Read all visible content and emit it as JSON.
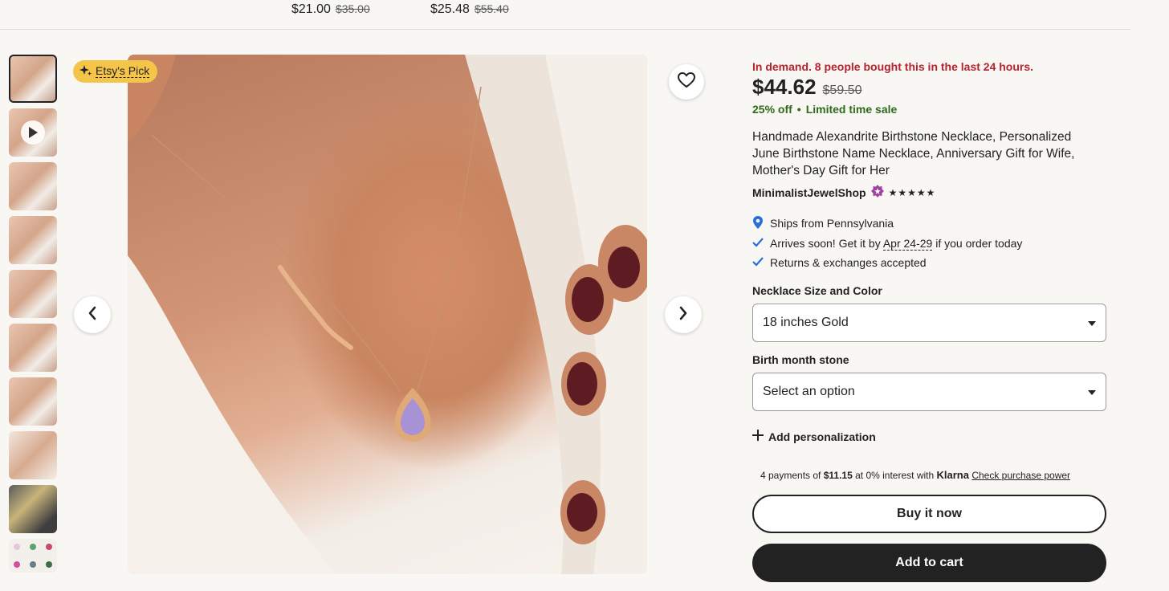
{
  "recommended": [
    {
      "price": "$21.00",
      "original": "$35.00"
    },
    {
      "price": "$25.48",
      "original": "$55.40"
    }
  ],
  "gallery": {
    "badge": "Etsy's Pick",
    "thumbnail_count": 10
  },
  "product": {
    "demand_notice": "In demand. 8 people bought this in the last 24 hours.",
    "price": "$44.62",
    "original_price": "$59.50",
    "discount": "25% off",
    "sale_label": "Limited time sale",
    "title": "Handmade Alexandrite Birthstone Necklace, Personalized June Birthstone Name Necklace, Anniversary Gift for Wife, Mother's Day Gift for Her",
    "shop_name": "MinimalistJewelShop",
    "rating_stars": "★★★★★"
  },
  "shipping": {
    "ships_from": "Ships from Pennsylvania",
    "arrives_prefix": "Arrives soon! Get it by",
    "arrives_dates": "Apr 24-29",
    "arrives_suffix": "if you order today",
    "returns": "Returns & exchanges accepted"
  },
  "options": {
    "size_label": "Necklace Size and Color",
    "size_value": "18 inches Gold",
    "stone_label": "Birth month stone",
    "stone_value": "Select an option"
  },
  "personalization": {
    "label": "Add personalization"
  },
  "financing": {
    "prefix": "4 payments of",
    "amount": "$11.15",
    "middle": "at 0% interest with",
    "brand": "Klarna",
    "link": "Check purchase power"
  },
  "actions": {
    "buy_now": "Buy it now",
    "add_to_cart": "Add to cart"
  },
  "colors": {
    "demand": "#b5232d",
    "sale": "#2f6a1b",
    "badge": "#f5c54a",
    "check": "#2a6ed9",
    "star_seller": "#a03fa0",
    "primary_button": "#222222"
  }
}
